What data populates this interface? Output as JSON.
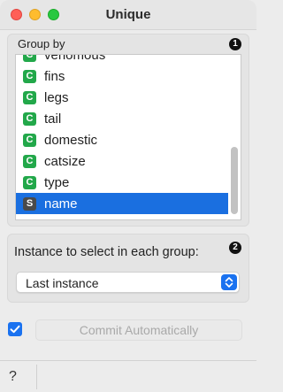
{
  "window": {
    "title": "Unique"
  },
  "group_by": {
    "label": "Group by",
    "info_badge": "1",
    "items": [
      {
        "type": "C",
        "label": "venomous"
      },
      {
        "type": "C",
        "label": "fins"
      },
      {
        "type": "C",
        "label": "legs"
      },
      {
        "type": "C",
        "label": "tail"
      },
      {
        "type": "C",
        "label": "domestic"
      },
      {
        "type": "C",
        "label": "catsize"
      },
      {
        "type": "C",
        "label": "type"
      },
      {
        "type": "S",
        "label": "name"
      }
    ],
    "selected": "name"
  },
  "instance": {
    "label": "Instance to select in each group:",
    "info_badge": "2",
    "selected_option": "Last instance"
  },
  "footer": {
    "auto_commit_checked": true,
    "commit_label": "Commit Automatically"
  },
  "statusbar": {
    "help_label": "?"
  },
  "colors": {
    "accent": "#1a6fe0",
    "continuous_badge": "#22a84a",
    "string_badge": "#4a4a4a"
  }
}
